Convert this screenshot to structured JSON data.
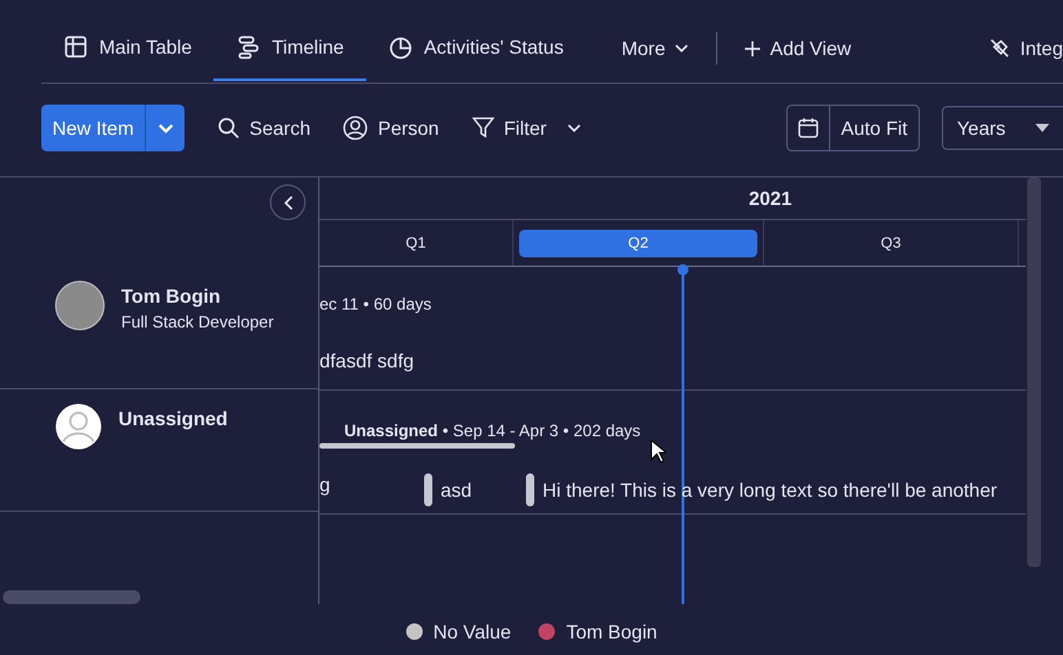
{
  "tabs": [
    {
      "label": "Main Table",
      "selected": false
    },
    {
      "label": "Timeline",
      "selected": true
    },
    {
      "label": "Activities' Status",
      "selected": false
    }
  ],
  "more": "More",
  "add_view": "Add View",
  "integrations": "Integ",
  "toolbar": {
    "new_item": "New Item",
    "search": "Search",
    "person": "Person",
    "filter": "Filter",
    "auto_fit": "Auto Fit",
    "scale": "Years"
  },
  "timeline": {
    "year": "2021",
    "quarters": [
      {
        "label": "Q1",
        "selected": false
      },
      {
        "label": "Q2",
        "selected": true
      },
      {
        "label": "Q3",
        "selected": false
      }
    ],
    "groups": [
      {
        "name": "Tom Bogin",
        "subtitle": "Full Stack Developer",
        "photo": true,
        "items": [
          {
            "kind": "summary",
            "text": "ec 11 • 60 days"
          },
          {
            "kind": "item",
            "text": "dfasdf sdfg",
            "handle": false
          }
        ]
      },
      {
        "name": "Unassigned",
        "photo": false,
        "items": [
          {
            "kind": "summary",
            "text": "**Unassigned** • Sep 14 - Apr 3 • 202 days",
            "bar": true
          },
          {
            "kind": "item",
            "text": "g",
            "handle": false
          },
          {
            "kind": "item",
            "text": "asd",
            "handle": true
          },
          {
            "kind": "item",
            "text": "Hi there! This is a very long text so there'll be another",
            "handle": true
          }
        ]
      }
    ]
  },
  "legend": [
    {
      "label": "No Value",
      "color": "#c4c4c4"
    },
    {
      "label": "Tom Bogin",
      "color": "#c04562"
    }
  ]
}
